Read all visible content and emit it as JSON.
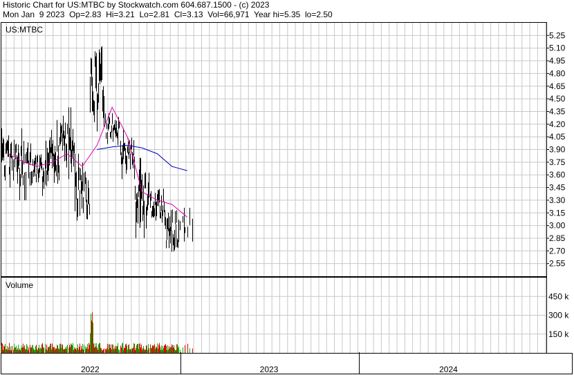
{
  "header": {
    "line1": "Historic Chart for US:MTBC by Stockwatch.com 604.687.1500 - (c) 2023",
    "line2": "Mon Jan  9 2023  Op=2.83  Hi=3.21  Lo=2.81  Cl=3.13  Vol=66,971  Year hi=5.35  lo=2.50"
  },
  "colors": {
    "price_bar": "#000000",
    "ma_short": "#e000b0",
    "ma_long": "#0000c0",
    "vol_up": "#00b000",
    "vol_down": "#e00000",
    "grid": "#c8c8c8"
  },
  "chart_data": [
    {
      "type": "line",
      "title": "US:MTBC",
      "ylim": [
        2.4,
        5.4
      ],
      "y_ticks": [
        "5.25",
        "5.10",
        "4.95",
        "4.80",
        "4.65",
        "4.50",
        "4.35",
        "4.20",
        "4.05",
        "3.90",
        "3.75",
        "3.60",
        "3.45",
        "3.30",
        "3.15",
        "3.00",
        "2.85",
        "2.70",
        "2.55"
      ],
      "x_ticks": [
        "2022",
        "2023",
        "2024"
      ],
      "xlim": [
        "2022-01-01",
        "2024-12-31"
      ],
      "last_bar": {
        "date": "2023-01-09",
        "open": 2.83,
        "high": 3.21,
        "low": 2.81,
        "close": 3.13
      },
      "price_series": [
        {
          "month": "2022-01",
          "high": 4.15,
          "low": 3.45
        },
        {
          "month": "2022-02",
          "high": 4.15,
          "low": 3.3
        },
        {
          "month": "2022-03",
          "high": 3.95,
          "low": 3.35
        },
        {
          "month": "2022-04",
          "high": 4.25,
          "low": 3.3
        },
        {
          "month": "2022-05",
          "high": 4.4,
          "low": 3.55
        },
        {
          "month": "2022-06",
          "high": 3.85,
          "low": 2.93
        },
        {
          "month": "2022-07",
          "high": 5.35,
          "low": 3.9
        },
        {
          "month": "2022-08",
          "high": 4.4,
          "low": 3.9
        },
        {
          "month": "2022-09",
          "high": 4.15,
          "low": 3.55
        },
        {
          "month": "2022-10",
          "high": 3.8,
          "low": 2.85
        },
        {
          "month": "2022-11",
          "high": 3.55,
          "low": 2.95
        },
        {
          "month": "2022-12",
          "high": 3.3,
          "low": 2.55
        },
        {
          "month": "2023-01",
          "high": 3.21,
          "low": 2.81
        }
      ],
      "ma_short": [
        3.85,
        3.75,
        3.7,
        3.75,
        3.85,
        3.7,
        3.95,
        4.4,
        4.05,
        3.4,
        3.3,
        3.25,
        3.1
      ],
      "ma_long": [
        3.9,
        3.93,
        3.95,
        3.92,
        3.85,
        3.7,
        3.65
      ]
    },
    {
      "type": "bar",
      "title": "Volume",
      "ylim": [
        0,
        600
      ],
      "y_ticks": [
        "450 k",
        "300 k",
        "150 k"
      ],
      "peak_volume_k": 360
    }
  ]
}
